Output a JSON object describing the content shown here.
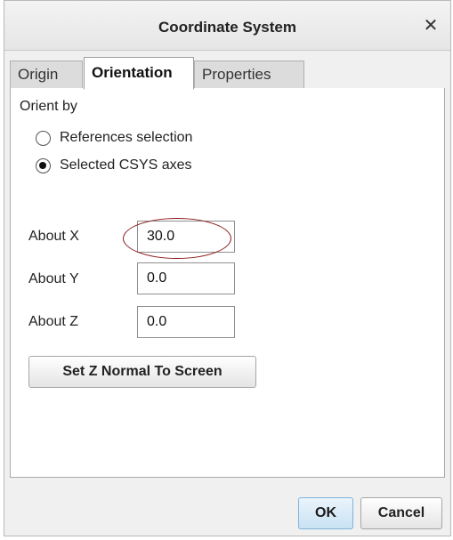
{
  "dialog": {
    "title": "Coordinate System",
    "close_icon_glyph": "✕"
  },
  "tabs": [
    {
      "label": "Origin",
      "active": false
    },
    {
      "label": "Orientation",
      "active": true
    },
    {
      "label": "Properties",
      "active": false
    }
  ],
  "orientation": {
    "orient_by_label": "Orient by",
    "options": [
      {
        "label": "References selection",
        "checked": false
      },
      {
        "label": "Selected CSYS axes",
        "checked": true
      }
    ],
    "about_x": {
      "label": "About X",
      "value": "30.0"
    },
    "about_y": {
      "label": "About Y",
      "value": "0.0"
    },
    "about_z": {
      "label": "About Z",
      "value": "0.0"
    },
    "set_z_normal_label": "Set Z Normal To Screen",
    "highlight_color": "#8b1a1a"
  },
  "footer": {
    "ok_label": "OK",
    "cancel_label": "Cancel"
  }
}
